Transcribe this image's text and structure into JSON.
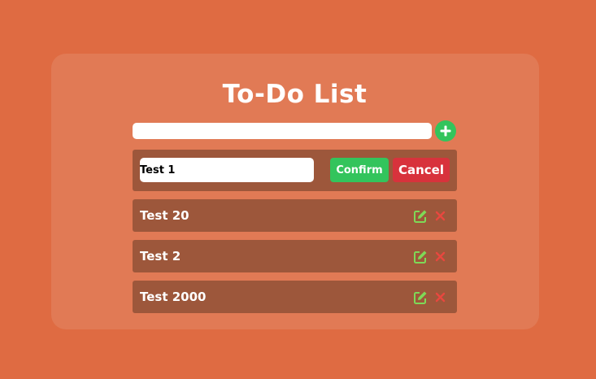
{
  "app": {
    "title": "To-Do List"
  },
  "new_task": {
    "value": "",
    "placeholder": "",
    "add_icon": "plus-icon"
  },
  "editing": {
    "value": "Test 1",
    "confirm_label": "Confirm",
    "cancel_label": "Cancel"
  },
  "items": [
    {
      "label": "Test 20"
    },
    {
      "label": "Test 2"
    },
    {
      "label": "Test 2000"
    }
  ],
  "icons": {
    "edit": "edit-icon",
    "delete": "close-icon"
  },
  "colors": {
    "background": "#df6b42",
    "card": "#e17a55",
    "row": "#9d573b",
    "accent_green": "#33c45c",
    "cancel_red": "#d8323c",
    "edit_icon": "#7ed957",
    "delete_icon": "#e8473f"
  }
}
